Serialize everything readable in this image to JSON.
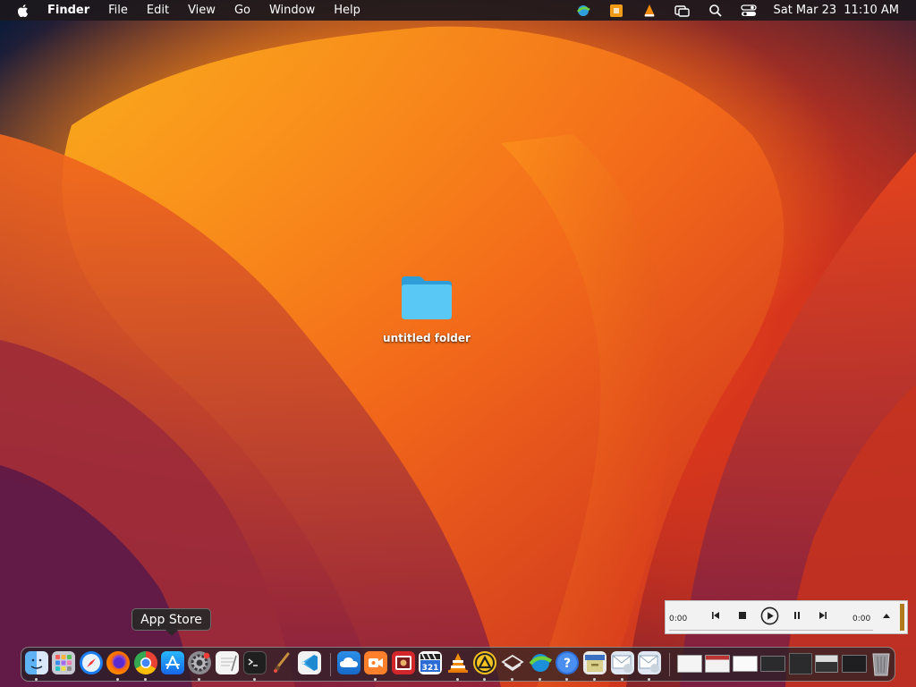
{
  "menubar": {
    "app_name": "Finder",
    "menus": [
      "File",
      "Edit",
      "View",
      "Go",
      "Window",
      "Help"
    ],
    "clock": {
      "date": "Sat Mar 23",
      "time": "11:10 AM"
    }
  },
  "desktop": {
    "folder_label": "untitled folder"
  },
  "tooltip": {
    "text": "App Store"
  },
  "player": {
    "elapsed": "0:00",
    "remaining": "0:00"
  },
  "dock": {
    "apps": [
      "Finder",
      "Launchpad",
      "Safari",
      "Firefox",
      "Chrome",
      "App Store",
      "System Preferences",
      "TextEdit",
      "Terminal",
      "Paintbrush",
      "Visual Studio Code"
    ],
    "other_apps": [
      "Cloud app",
      "Screen Recorder",
      "Photo Booth",
      "Countdown",
      "VLC",
      "Transmission",
      "Layers",
      "Internet",
      "Help",
      "Archive",
      "Mail app",
      "Mail app 2"
    ],
    "minimized_windows": 7,
    "trash": "Trash"
  },
  "colors": {
    "accent_folder": "#44b7ee",
    "menubar_bg": "#1c181c"
  }
}
